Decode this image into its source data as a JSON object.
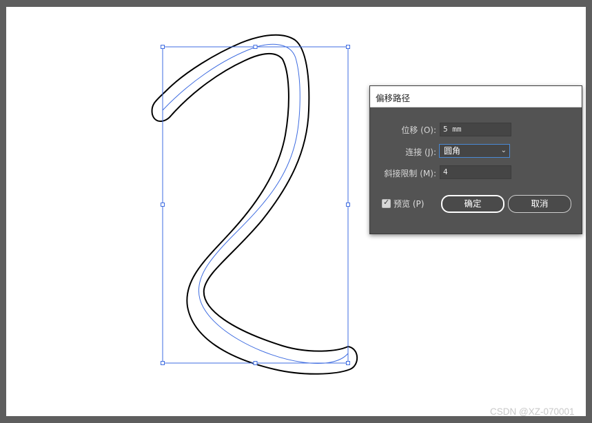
{
  "dialog": {
    "title": "偏移路径",
    "offset": {
      "label": "位移 (O):",
      "value": "5 mm"
    },
    "join": {
      "label": "连接 (J):",
      "selected": "圆角"
    },
    "miter_limit": {
      "label": "斜接限制 (M):",
      "value": "4"
    },
    "preview": {
      "label": "预览 (P)",
      "checked": true
    },
    "ok_label": "确定",
    "cancel_label": "取消"
  },
  "watermark": "CSDN @XZ-070001",
  "colors": {
    "app_background": "#5e5e5e",
    "artboard": "#ffffff",
    "selection": "#3d6be0",
    "path_stroke": "#000000",
    "dialog_background": "#535353",
    "input_focus": "#4a8ad6"
  }
}
